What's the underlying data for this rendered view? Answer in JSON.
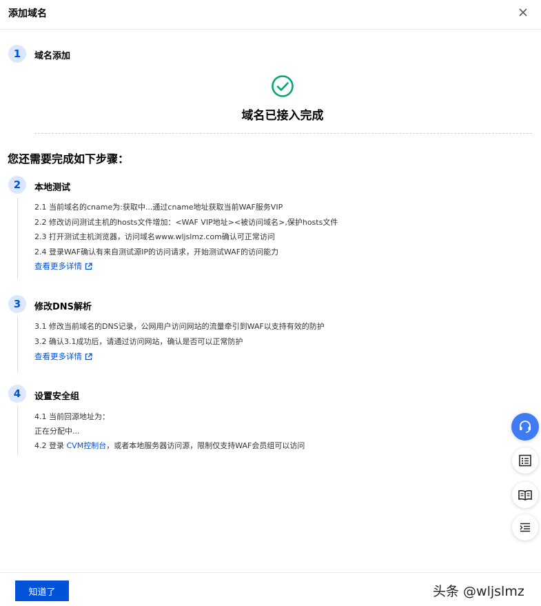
{
  "dialog": {
    "title": "添加域名",
    "close_icon": "close-icon"
  },
  "step1": {
    "number": "1",
    "title": "域名添加",
    "status": "域名已接入完成"
  },
  "remaining_title": "您还需要完成如下步骤：",
  "step2": {
    "number": "2",
    "title": "本地测试",
    "lines": [
      "2.1 当前域名的cname为:获取中...通过cname地址获取当前WAF服务VIP",
      "2.2 修改访问测试主机的hosts文件增加：<WAF VIP地址><被访问域名>,保护hosts文件",
      "2.3 打开测试主机浏览器，访问域名www.wljslmz.com确认可正常访问",
      "2.4 登录WAF确认有来自测试源IP的访问请求，开始测试WAF的访问能力"
    ],
    "link": "查看更多详情"
  },
  "step3": {
    "number": "3",
    "title": "修改DNS解析",
    "lines": [
      "3.1 修改当前域名的DNS记录，公网用户访问网站的流量牵引到WAF以支持有效的防护",
      "3.2 确认3.1成功后，请通过访问网站，确认是否可以正常防护"
    ],
    "link": "查看更多详情"
  },
  "step4": {
    "number": "4",
    "title": "设置安全组",
    "line1": "4.1 当前回源地址为：",
    "line2": "正在分配中...",
    "line3_prefix": "4.2 登录 ",
    "line3_link": "CVM控制台",
    "line3_suffix": "，或者本地服务器访问源，限制仅支持WAF会员组可以访问"
  },
  "footer": {
    "ok_label": "知道了"
  },
  "watermark": "头条 @wljslmz",
  "float_icons": [
    "headset-icon",
    "list-icon",
    "book-icon",
    "outline-icon"
  ],
  "colors": {
    "accent": "#0052d9",
    "success": "#00a870",
    "step_bg": "#dbe7fd"
  }
}
